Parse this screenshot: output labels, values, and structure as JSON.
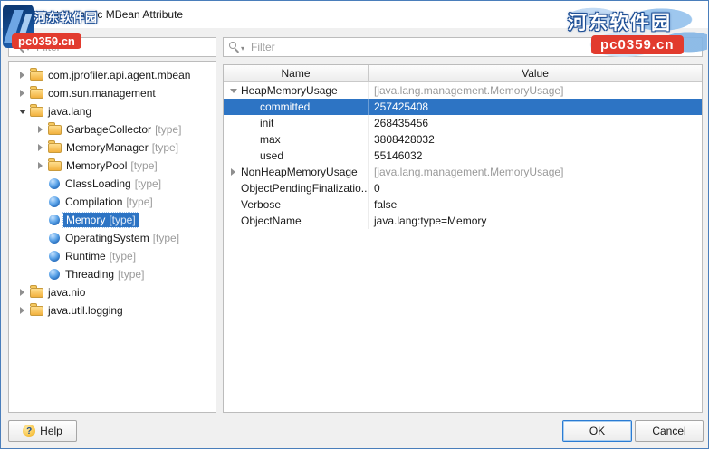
{
  "window": {
    "title": "Select Numeric MBean Attribute"
  },
  "watermark": {
    "site": "河东软件园",
    "url": "pc0359.cn"
  },
  "filters": {
    "left_placeholder": "Filter",
    "right_placeholder": "Filter"
  },
  "tree": {
    "items": [
      {
        "label": "com.jprofiler.api.agent.mbean"
      },
      {
        "label": "com.sun.management"
      },
      {
        "label": "java.lang"
      },
      {
        "label": "GarbageCollector",
        "suffix": "[type]"
      },
      {
        "label": "MemoryManager",
        "suffix": "[type]"
      },
      {
        "label": "MemoryPool",
        "suffix": "[type]"
      },
      {
        "label": "ClassLoading",
        "suffix": "[type]"
      },
      {
        "label": "Compilation",
        "suffix": "[type]"
      },
      {
        "label": "Memory",
        "suffix": "[type]"
      },
      {
        "label": "OperatingSystem",
        "suffix": "[type]"
      },
      {
        "label": "Runtime",
        "suffix": "[type]"
      },
      {
        "label": "Threading",
        "suffix": "[type]"
      },
      {
        "label": "java.nio"
      },
      {
        "label": "java.util.logging"
      }
    ]
  },
  "table": {
    "columns": {
      "name": "Name",
      "value": "Value"
    },
    "rows": [
      {
        "name": "HeapMemoryUsage",
        "value": "[java.lang.management.MemoryUsage]"
      },
      {
        "name": "committed",
        "value": "257425408"
      },
      {
        "name": "init",
        "value": "268435456"
      },
      {
        "name": "max",
        "value": "3808428032"
      },
      {
        "name": "used",
        "value": "55146032"
      },
      {
        "name": "NonHeapMemoryUsage",
        "value": "[java.lang.management.MemoryUsage]"
      },
      {
        "name": "ObjectPendingFinalizatio...",
        "value": "0"
      },
      {
        "name": "Verbose",
        "value": "false"
      },
      {
        "name": "ObjectName",
        "value": "java.lang:type=Memory"
      }
    ]
  },
  "buttons": {
    "help": "Help",
    "ok": "OK",
    "cancel": "Cancel"
  },
  "icons": {
    "search": "magnifier-icon",
    "folder": "yellow-folder-icon",
    "mbean": "blue-sphere-icon",
    "help": "question-circle-icon"
  },
  "colors": {
    "selection": "#2d74c4",
    "watermark_red": "#e23b2e",
    "watermark_blue": "#1d4e95",
    "muted_text": "#9a9a9a"
  }
}
